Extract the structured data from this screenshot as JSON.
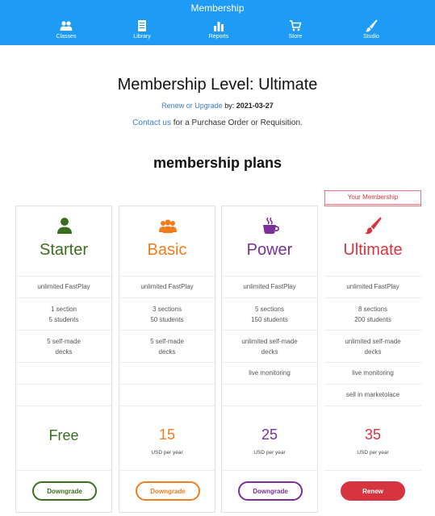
{
  "header": {
    "title": "Membership",
    "nav": [
      {
        "label": "Classes",
        "icon": "users-icon"
      },
      {
        "label": "Library",
        "icon": "book-icon"
      },
      {
        "label": "Reports",
        "icon": "bar-chart-icon"
      },
      {
        "label": "Store",
        "icon": "cart-icon"
      },
      {
        "label": "Studio",
        "icon": "paintbrush-icon"
      }
    ]
  },
  "membership": {
    "title": "Membership Level: Ultimate",
    "renew_link": "Renew or Upgrade",
    "renew_by": "by:",
    "renew_date": "2021-03-27",
    "contact_link": "Contact us",
    "contact_text": "for a Purchase Order or Requisition.",
    "plans_title": "membership plans",
    "your_membership_label": "Your Membership"
  },
  "colors": {
    "header": "#1e9bf5",
    "starter": "#3a6e1f",
    "basic": "#f37d1d",
    "power": "#7a2f9a",
    "ultimate": "#d8343f"
  },
  "plans": [
    {
      "name": "Starter",
      "icon": "user-icon",
      "rows": [
        "unlimited FastPlay",
        "1 section\n5 students",
        "5 self-made\ndecks",
        "",
        ""
      ],
      "price": "Free",
      "per": "",
      "button": "Downgrade"
    },
    {
      "name": "Basic",
      "icon": "users-icon",
      "rows": [
        "unlimited FastPlay",
        "3 sections\n50 students",
        "5 self-made\ndecks",
        "",
        ""
      ],
      "price": "15",
      "per": "USD per year",
      "button": "Downgrade"
    },
    {
      "name": "Power",
      "icon": "coffee-cup-icon",
      "rows": [
        "unlimited FastPlay",
        "5 sections\n150 students",
        "unlimited self-made\ndecks",
        "live monitoring",
        ""
      ],
      "price": "25",
      "per": "USD per year",
      "button": "Downgrade"
    },
    {
      "name": "Ultimate",
      "icon": "paintbrush-icon",
      "rows": [
        "unlimited FastPlay",
        "8 sections\n200 students",
        "unlimited self-made\ndecks",
        "live monitoring",
        "sell in marketolace"
      ],
      "price": "35",
      "per": "USD per year",
      "button": "Renew"
    }
  ]
}
